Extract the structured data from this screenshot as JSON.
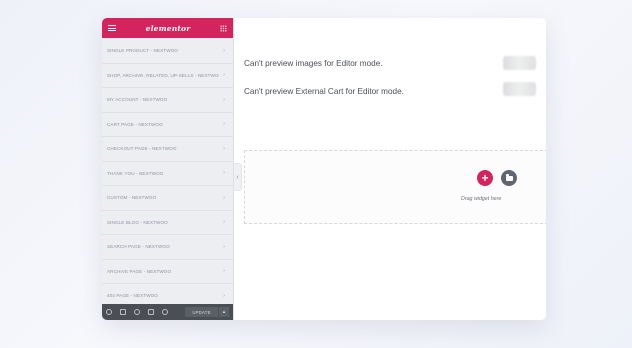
{
  "sidebar": {
    "brand": "elementor",
    "header_icons": {
      "menu": "hamburger-menu-icon",
      "grid": "apps-grid-icon"
    },
    "items": [
      {
        "label": "SINGLE PRODUCT - NEXTWOO",
        "arrow": "›"
      },
      {
        "label": "SHOP, ARCHIVE, RELATED, UP-SELLS - NEXTWOO",
        "arrow": "›"
      },
      {
        "label": "MY ACCOUNT - NEXTWOO",
        "arrow": "›"
      },
      {
        "label": "CART PAGE - NEXTWOO",
        "arrow": "›"
      },
      {
        "label": "CHECKOUT PAGE - NEXTWOO",
        "arrow": "›"
      },
      {
        "label": "THANK YOU - NEXTWOO",
        "arrow": "›"
      },
      {
        "label": "CUSTOM - NEXTWOO",
        "arrow": "›"
      },
      {
        "label": "SINGLE BLOG - NEXTWOO",
        "arrow": "›"
      },
      {
        "label": "SEARCH PAGE - NEXTWOO",
        "arrow": "›"
      },
      {
        "label": "ARCHIVE PAGE - NEXTWOO",
        "arrow": "›"
      },
      {
        "label": "404 PAGE - NEXTWOO",
        "arrow": "›"
      }
    ],
    "footer": {
      "icons": [
        "settings-icon",
        "layers-icon",
        "history-icon",
        "responsive-icon",
        "preview-eye-icon"
      ],
      "update_label": "UPDATE",
      "update_arrow": "▴"
    }
  },
  "collapse_arrow": "‹",
  "main": {
    "messages": [
      "Can't preview images for Editor mode.",
      "Can't preview External Cart for Editor mode."
    ],
    "drop_zone": {
      "add_symbol": "+",
      "drag_label": "Drag widget here"
    }
  },
  "colors": {
    "brand_pink": "#d3245d",
    "footer_gray": "#4b4e55",
    "folder_gray": "#5f6670"
  }
}
